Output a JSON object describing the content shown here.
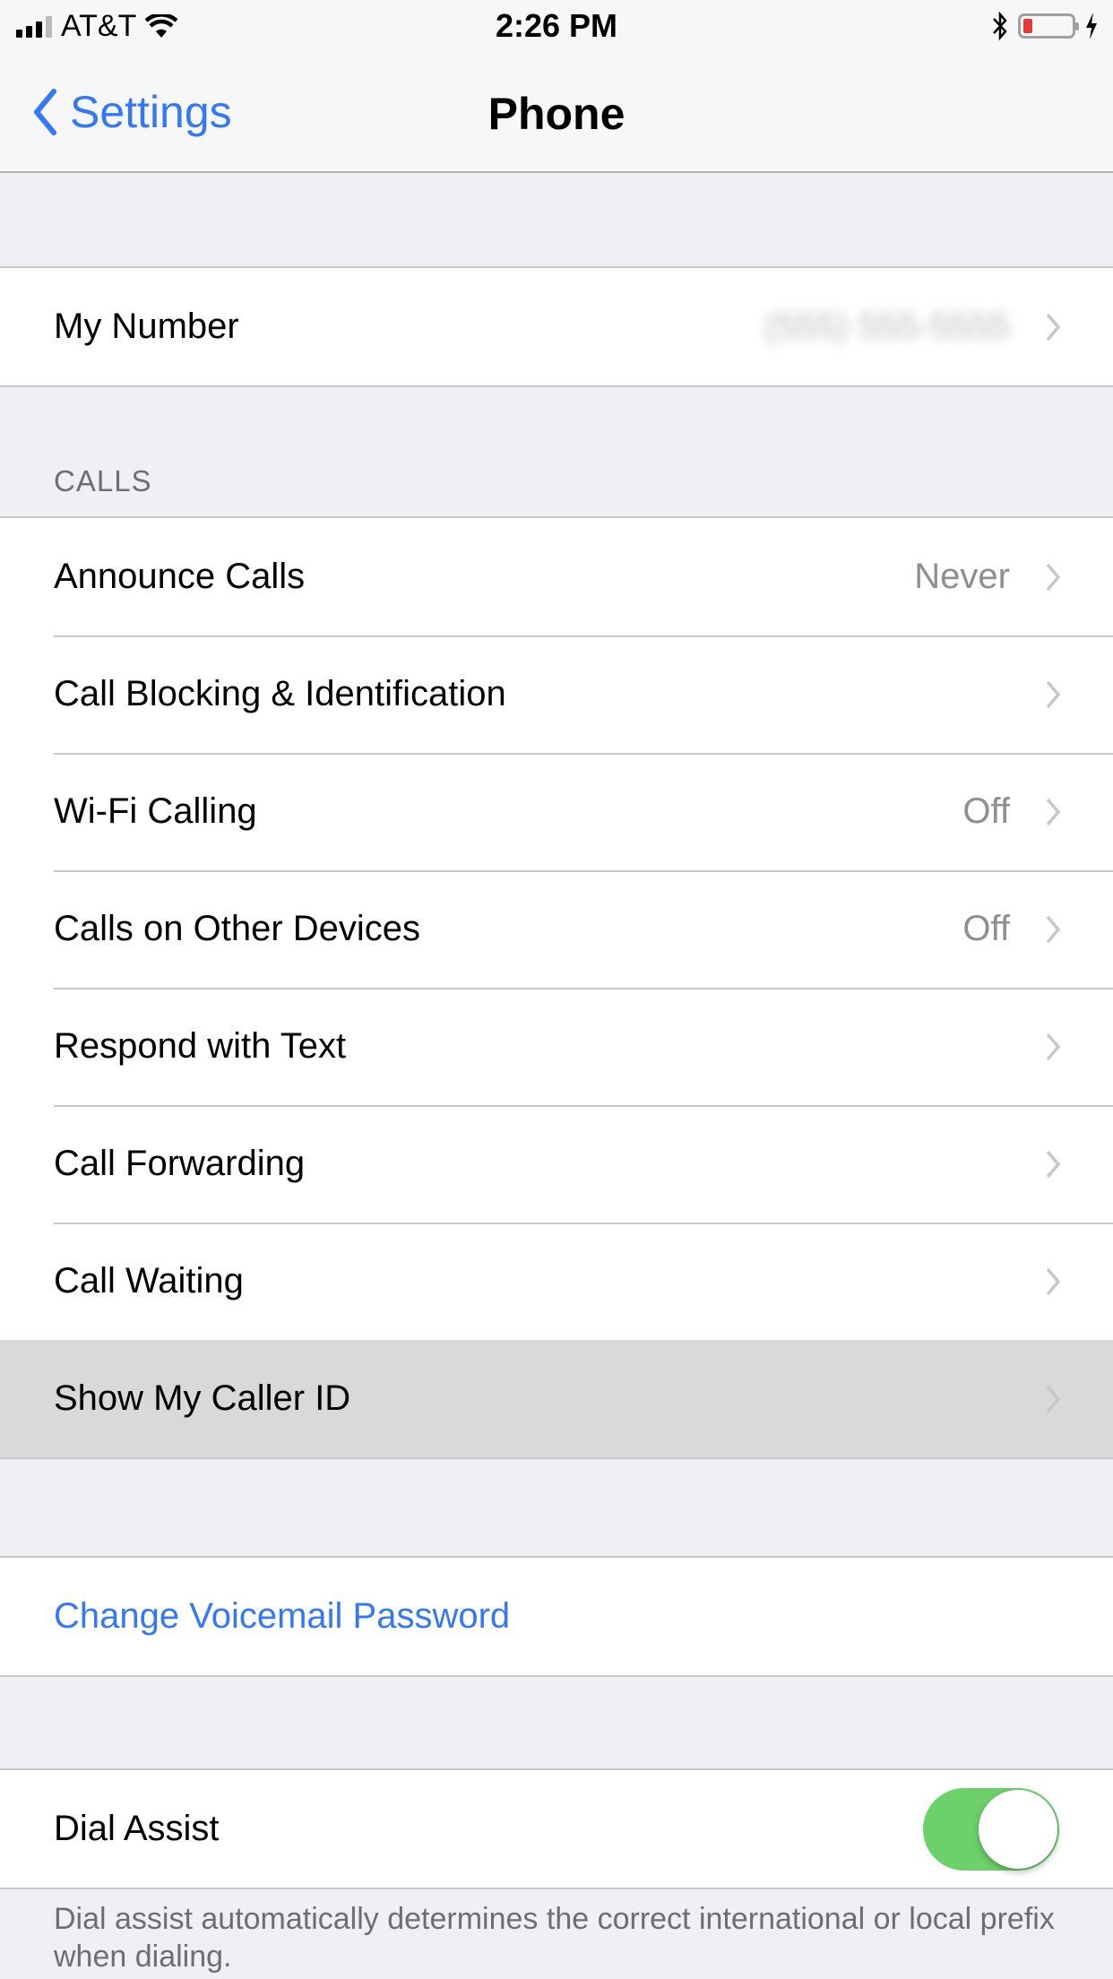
{
  "status_bar": {
    "carrier": "AT&T",
    "time": "2:26 PM",
    "icons": [
      "signal-icon",
      "wifi-icon",
      "bluetooth-icon",
      "battery-icon",
      "charging-icon"
    ],
    "battery_level_percent": 10,
    "battery_color": "#e53935"
  },
  "nav": {
    "back_label": "Settings",
    "title": "Phone",
    "accent_color": "#3478f6"
  },
  "my_number": {
    "label": "My Number",
    "value": "(555) 555-5555"
  },
  "calls_section": {
    "header": "CALLS",
    "items": [
      {
        "label": "Announce Calls",
        "value": "Never"
      },
      {
        "label": "Call Blocking & Identification",
        "value": ""
      },
      {
        "label": "Wi-Fi Calling",
        "value": "Off"
      },
      {
        "label": "Calls on Other Devices",
        "value": "Off"
      },
      {
        "label": "Respond with Text",
        "value": ""
      },
      {
        "label": "Call Forwarding",
        "value": ""
      },
      {
        "label": "Call Waiting",
        "value": ""
      },
      {
        "label": "Show My Caller ID",
        "value": "",
        "highlighted": true
      }
    ]
  },
  "voicemail": {
    "label": "Change Voicemail Password"
  },
  "dial_assist": {
    "label": "Dial Assist",
    "enabled": true,
    "toggle_color": "#6dd16b",
    "footer": "Dial assist automatically determines the correct international or local prefix when dialing."
  }
}
